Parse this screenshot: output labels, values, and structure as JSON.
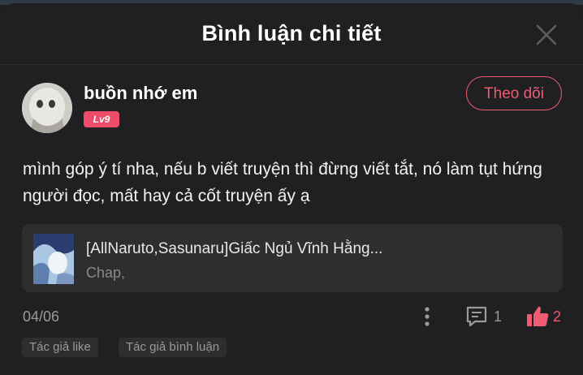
{
  "header": {
    "title": "Bình luận chi tiết"
  },
  "comment": {
    "username": "buồn nhớ em",
    "level": "Lv9",
    "follow_label": "Theo dõi",
    "text": "mình góp ý tí nha, nếu b viết truyện thì đừng viết tắt, nó làm tụt hứng người đọc, mất hay cả cốt truyện ấy ạ",
    "date": "04/06",
    "reply_count": "1",
    "like_count": "2"
  },
  "story_card": {
    "title": "[AllNaruto,Sasunaru]Giấc Ngủ Vĩnh Hằng...",
    "subtitle": "Chap,"
  },
  "tags": [
    "Tác giả like",
    "Tác giả bình luận"
  ],
  "colors": {
    "accent": "#ef5a72",
    "background": "#202022",
    "card": "#2e2e30"
  }
}
